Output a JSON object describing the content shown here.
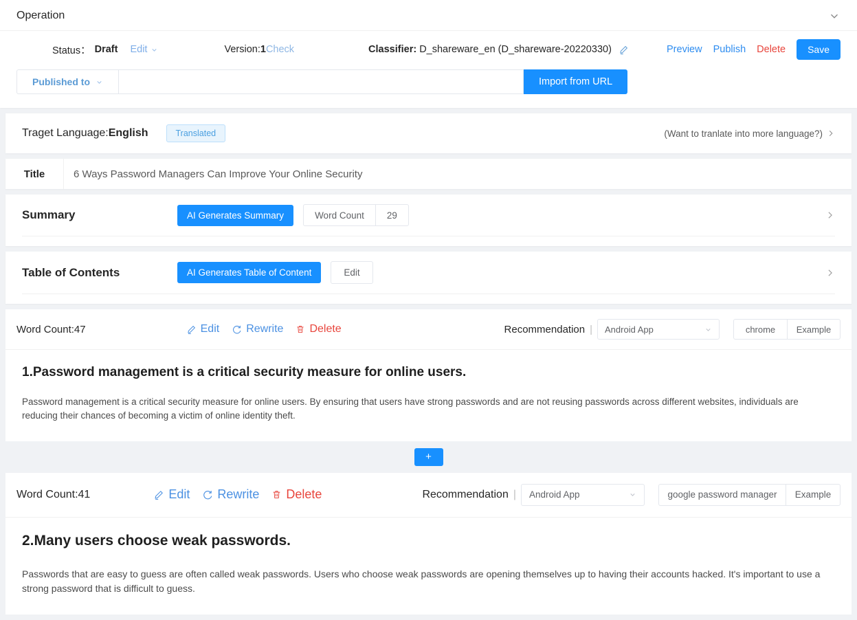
{
  "operation": {
    "title": "Operation",
    "collapse_icon": "chevron-down-icon",
    "status_label": "Status：",
    "status_value": "Draft",
    "edit_label": "Edit",
    "version_label": "Version:",
    "version_value": "1",
    "check_label": "Check",
    "classifier_label": "Classifier:",
    "classifier_value": "D_shareware_en (D_shareware-20220330)",
    "classifier_edit_icon": "pencil-icon",
    "preview_label": "Preview",
    "publish_label": "Publish",
    "delete_label": "Delete",
    "save_label": "Save",
    "published_to_label": "Published to",
    "url_input_value": "",
    "url_input_placeholder": "",
    "import_label": "Import from URL"
  },
  "language": {
    "label": "Traget Language:",
    "value": "English",
    "badge": "Translated",
    "hint": "(Want to tranlate into more language?)"
  },
  "title_section": {
    "label": "Title",
    "value": "6 Ways Password Managers Can Improve Your Online Security"
  },
  "summary": {
    "title": "Summary",
    "ai_button": "AI Generates Summary",
    "word_count_label": "Word Count",
    "word_count_value": "29"
  },
  "toc": {
    "title": "Table of Contents",
    "ai_button": "AI Generates Table of Content",
    "edit_button": "Edit"
  },
  "blocks": [
    {
      "word_count": "Word Count:47",
      "edit": "Edit",
      "rewrite": "Rewrite",
      "delete": "Delete",
      "recommendation_label": "Recommendation",
      "platform": "Android App",
      "keyword": "chrome",
      "example": "Example",
      "heading": "1.Password management is a critical security measure for online users.",
      "paragraph": "Password management is a critical security measure for online users. By ensuring that users have strong passwords and are not reusing passwords across different websites, individuals are reducing their chances of becoming a victim of online identity theft."
    },
    {
      "word_count": "Word Count:41",
      "edit": "Edit",
      "rewrite": "Rewrite",
      "delete": "Delete",
      "recommendation_label": "Recommendation",
      "platform": "Android App",
      "keyword": "google password manager",
      "example": "Example",
      "heading": "2.Many users choose weak passwords.",
      "paragraph": "Passwords that are easy to guess are often called weak passwords. Users who choose weak passwords are opening themselves up to having their accounts hacked. It's important to use a strong password that is difficult to guess."
    }
  ],
  "add_button": {
    "label": "+"
  },
  "colors": {
    "primary_blue": "#1890ff",
    "link_blue": "#4a90e2",
    "danger_red": "#e8453c",
    "badge_bg": "#e8f4fd",
    "page_bg": "#f0f2f5"
  }
}
